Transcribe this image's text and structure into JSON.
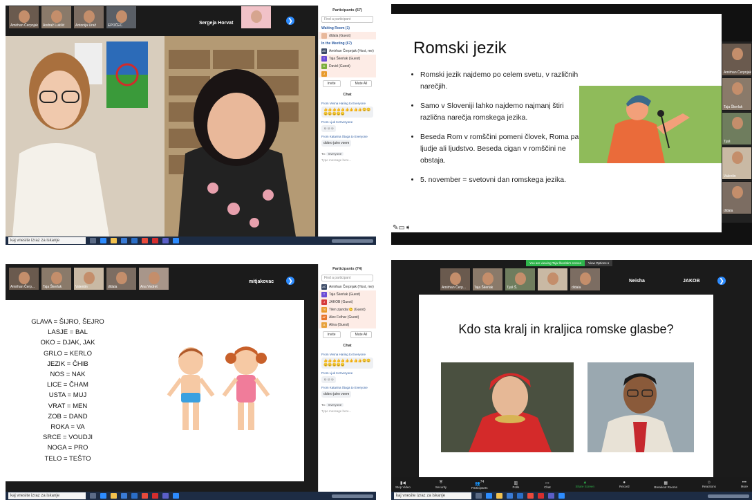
{
  "q1": {
    "participant_tiles": [
      {
        "name": "Amirhan Čerpnjak"
      },
      {
        "name": "Andraž Lukšić"
      },
      {
        "name": "Antonija Uraž"
      },
      {
        "name": "EPOČEC"
      }
    ],
    "speaker_name": "Sergeja Horvat",
    "participants_header": "Participants (67)",
    "search_placeholder": "Find a participant",
    "waiting_room_label": "Waiting Room (1)",
    "waiting": [
      {
        "name": "dldala (Guest)",
        "initials": "",
        "color": "#e8b89b"
      }
    ],
    "in_meeting_label": "In the Meeting (67)",
    "people": [
      {
        "initials": "AČ",
        "name": "Amirhan Čerpnjak (Host, me)",
        "color": "#3b4a66"
      },
      {
        "initials": "T",
        "name": "Taja Škerlak (Guest)",
        "color": "#6b4bd6"
      },
      {
        "initials": "D",
        "name": "David (Guest)",
        "color": "#7cae3b"
      },
      {
        "initials": "J",
        "name": "",
        "color": "#e89a2c"
      }
    ],
    "invite_label": "Invite",
    "mute_all_label": "Mute All",
    "chat_header": "Chat",
    "chat": [
      {
        "from": "From Vesna Haring to Everyone",
        "msg": "👍👍👍👍👍👍👍👍👍😊😊😊😊😊😊😊"
      },
      {
        "from": "From Ljuk to Everyone",
        "msg": "☺☺☺"
      },
      {
        "from": "From Katarina Štuga to Everyone",
        "msg": "dobro jutro vsem"
      }
    ],
    "to_label": "To:",
    "to_value": "Everyone",
    "message_placeholder": "Type message here...",
    "taskbar_search": "kaj vnesite izraz za iskanje"
  },
  "q2": {
    "slide_title": "Romski jezik",
    "bullets": [
      "Romski jezik najdemo po celem svetu, v različnih narečjih.",
      "Samo v Sloveniji lahko najdemo najmanj štiri različna narečja romskega jezika.",
      "Beseda Rom v romščini pomeni človek, Roma pa ljudje ali ljudstvo. Beseda cigan v romščini ne obstaja.",
      "5. november = svetovni dan romskega jezika."
    ],
    "thumbnails": [
      {
        "name": "Amirhan Čerpnjak"
      },
      {
        "name": "Taja Škerlak"
      },
      {
        "name": "Tjaš"
      },
      {
        "name": "Valentin"
      },
      {
        "name": "dldala"
      }
    ]
  },
  "q3": {
    "participant_tiles": [
      {
        "name": "Amirhan Čerp..."
      },
      {
        "name": "Taja Škerlak"
      },
      {
        "name": "Valentin"
      },
      {
        "name": "dldala"
      },
      {
        "name": "Ana Vedret"
      }
    ],
    "speaker_name": "mitjakovac",
    "participants_header": "Participants (74)",
    "search_placeholder": "Find a participant",
    "people": [
      {
        "initials": "AČ",
        "name": "Amirhan Čerpnjak (Host, me)",
        "color": "#3b4a66"
      },
      {
        "initials": "T",
        "name": "Taja Škerlak (Guest)",
        "color": "#6b4bd6"
      },
      {
        "initials": "J",
        "name": "JAKOB (Guest)",
        "color": "#d63b3b"
      },
      {
        "initials": "TŠ",
        "name": "Tilen zjandar😊 (Guest)",
        "color": "#e89a2c"
      },
      {
        "initials": "AF",
        "name": "Alex Felhar (Guest)",
        "color": "#e8762c"
      },
      {
        "initials": "A",
        "name": "Alina (Guest)",
        "color": "#e8a23c"
      }
    ],
    "invite_label": "Invite",
    "mute_all_label": "Mute All",
    "chat_header": "Chat",
    "chat": [
      {
        "from": "From Vesna Haring to Everyone",
        "msg": "👍👍👍👍👍👍👍👍👍😊😊😊😊😊😊😊"
      },
      {
        "from": "From Ljuk to Everyone",
        "msg": "☺☺☺"
      },
      {
        "from": "From Katarina Štuga to Everyone",
        "msg": "dobro jutro vsem"
      }
    ],
    "to_label": "To:",
    "to_value": "Everyone",
    "message_placeholder": "Type message here...",
    "vocab": [
      "GLAVA = ŠIJRO, ŠEJRO",
      "LASJE = BAL",
      "OKO = DJAK, JAK",
      "GRLO = KERLO",
      "JEZIK = ČHIB",
      "NOS = NAK",
      "LICE = ČHAM",
      "USTA = MUJ",
      "VRAT = MEN",
      "ZOB = DAND",
      "ROKA = VA",
      "SRCE = VOUDJI",
      "NOGA = PRO",
      "TELO = TEŠTO"
    ],
    "taskbar_search": "kaj vnesite izraz za iskanje"
  },
  "q4": {
    "banner_text": "You are viewing Taja Škerlak's screen",
    "view_options": "View Options ▾",
    "participant_tiles": [
      {
        "name": "Amirhan Čerp..."
      },
      {
        "name": "Taja Škerlak"
      },
      {
        "name": "Tjaš Š."
      },
      {
        "name": ""
      },
      {
        "name": "dldala"
      }
    ],
    "name_tiles": [
      {
        "name": "Neisha"
      },
      {
        "name": "JAKOB"
      }
    ],
    "slide_title": "Kdo sta kralj in kraljica romske glasbe?",
    "controls": [
      {
        "label": "Stop Video",
        "icon": "▮◀"
      },
      {
        "label": "Security",
        "icon": "⛨"
      },
      {
        "label": "Participants",
        "icon": "👥",
        "badge": "74"
      },
      {
        "label": "Polls",
        "icon": "▥"
      },
      {
        "label": "Chat",
        "icon": "▭"
      },
      {
        "label": "Share Screen",
        "icon": "▲"
      },
      {
        "label": "Record",
        "icon": "●"
      },
      {
        "label": "Breakout Rooms",
        "icon": "▦"
      },
      {
        "label": "Reactions",
        "icon": "☺"
      },
      {
        "label": "More",
        "icon": "•••"
      }
    ],
    "taskbar_search": "kaj vnesite izraz za iskanje"
  }
}
